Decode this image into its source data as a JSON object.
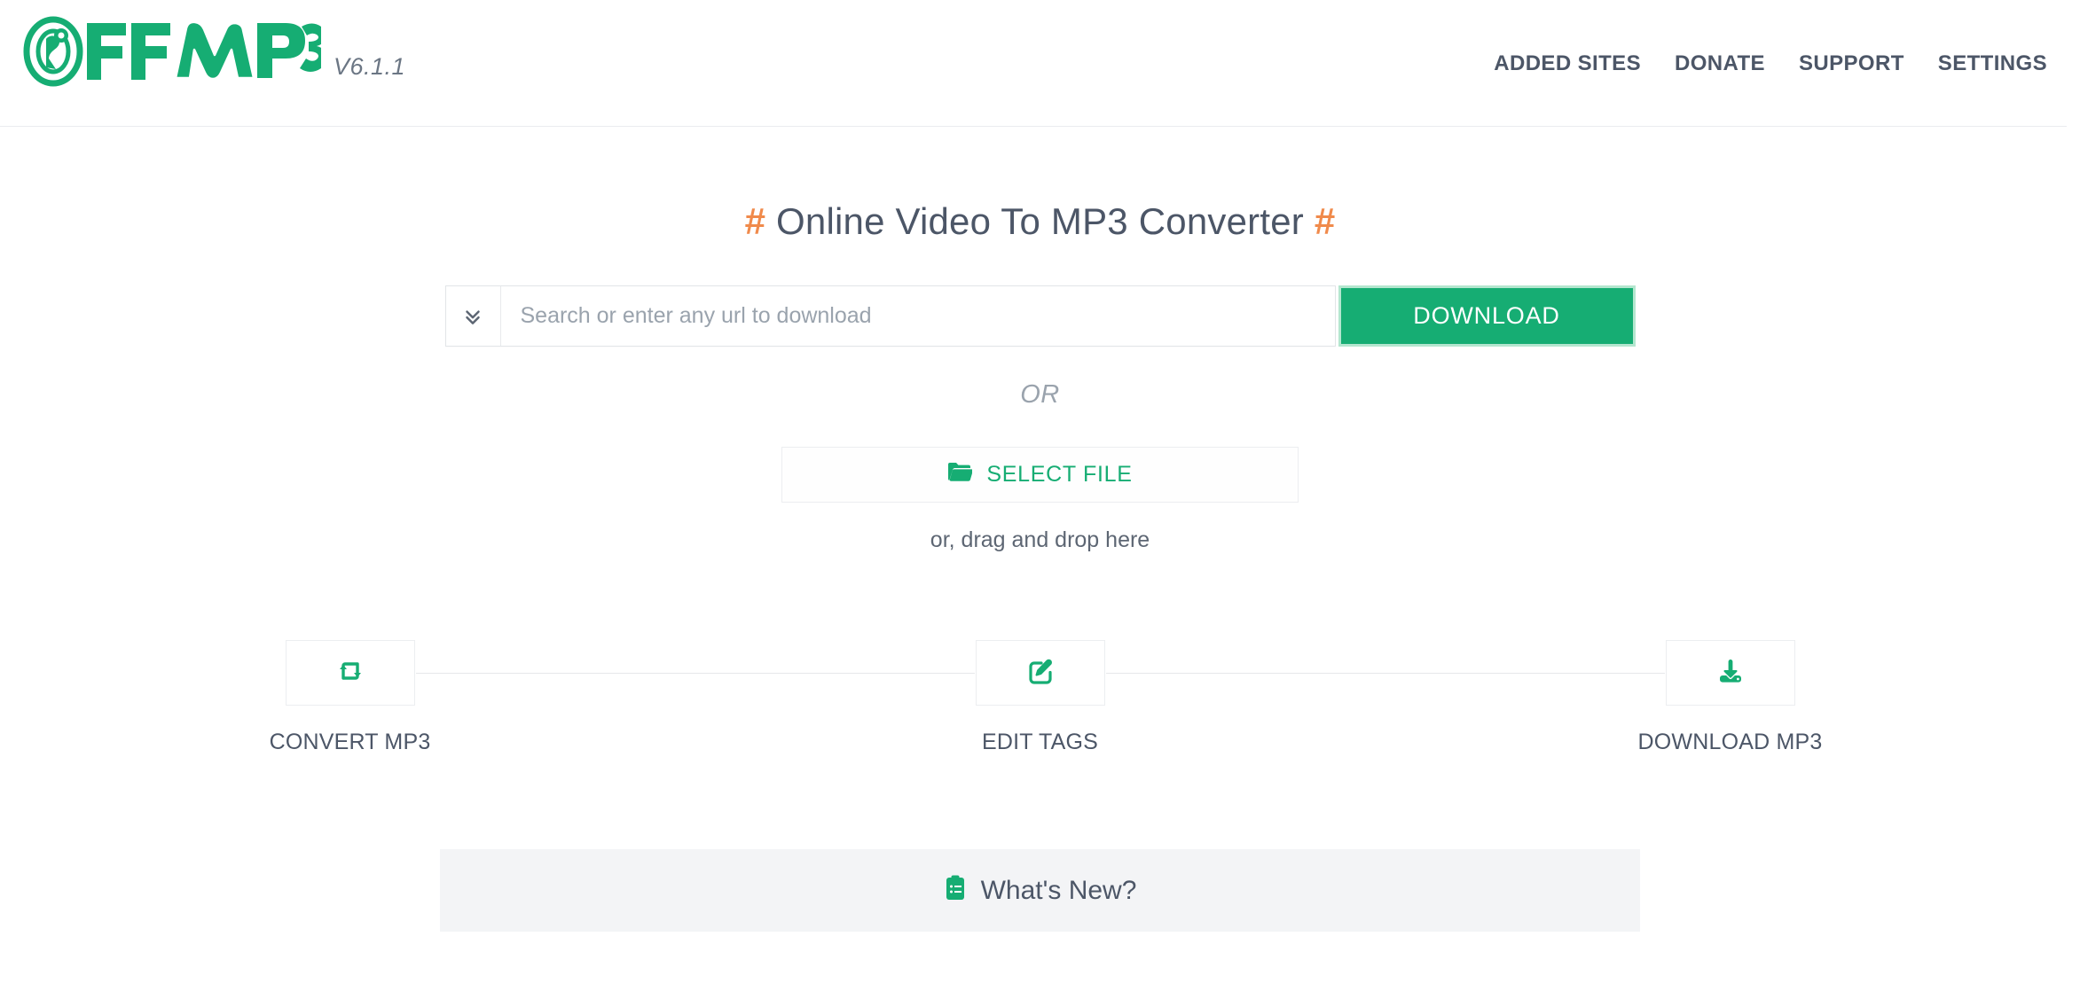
{
  "header": {
    "logo_text": "OFFMP3",
    "logo_icon": "offmp3-logo",
    "version": "V6.1.1",
    "nav": [
      {
        "label": "ADDED SITES",
        "name": "nav-added-sites"
      },
      {
        "label": "DONATE",
        "name": "nav-donate"
      },
      {
        "label": "SUPPORT",
        "name": "nav-support"
      },
      {
        "label": "SETTINGS",
        "name": "nav-settings"
      }
    ]
  },
  "main": {
    "title": "Online Video To MP3 Converter",
    "title_decoration": "#",
    "url_input": {
      "value": "",
      "placeholder": "Search or enter any url to download",
      "dropdown_icon": "angle-double-down-icon"
    },
    "download_button": "DOWNLOAD",
    "or_text": "OR",
    "select_file": {
      "label": "SELECT FILE",
      "icon": "folder-open-icon"
    },
    "drag_drop_text": "or, drag and drop here",
    "steps": [
      {
        "label": "CONVERT MP3",
        "icon": "retweet-icon",
        "name": "step-convert-mp3"
      },
      {
        "label": "EDIT TAGS",
        "icon": "pen-square-icon",
        "name": "step-edit-tags"
      },
      {
        "label": "DOWNLOAD MP3",
        "icon": "download-save-icon",
        "name": "step-download-mp3"
      }
    ],
    "whats_new": {
      "label": "What's New?",
      "icon": "clipboard-list-icon"
    }
  },
  "colors": {
    "brand_green": "#16ad73",
    "accent_orange": "#f08a4b",
    "text_dark": "#4c5667",
    "muted": "#9aa3ad",
    "panel_bg": "#f3f4f6"
  }
}
